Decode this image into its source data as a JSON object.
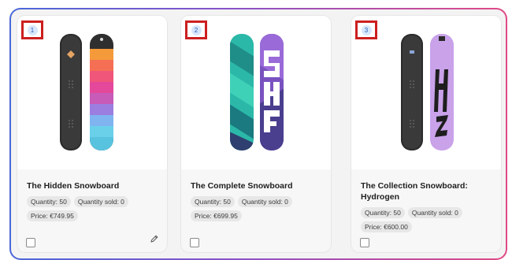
{
  "products": [
    {
      "index": "1",
      "title": "The Hidden Snowboard",
      "quantity": "Quantity: 50",
      "quantity_sold": "Quantity sold: 0",
      "price": "Price: €749.95"
    },
    {
      "index": "2",
      "title": "The Complete Snowboard",
      "quantity": "Quantity: 50",
      "quantity_sold": "Quantity sold: 0",
      "price": "Price: €699.95"
    },
    {
      "index": "3",
      "title": "The Collection Snowboard: Hydrogen",
      "quantity": "Quantity: 50",
      "quantity_sold": "Quantity sold: 0",
      "price": "Price: €600.00"
    }
  ],
  "icons": {
    "edit": "pencil-icon",
    "select": "checkbox"
  },
  "colors": {
    "marker_border": "#cc1f1f",
    "frame_gradient_start": "#4a68d8",
    "frame_gradient_end": "#e04a86"
  }
}
